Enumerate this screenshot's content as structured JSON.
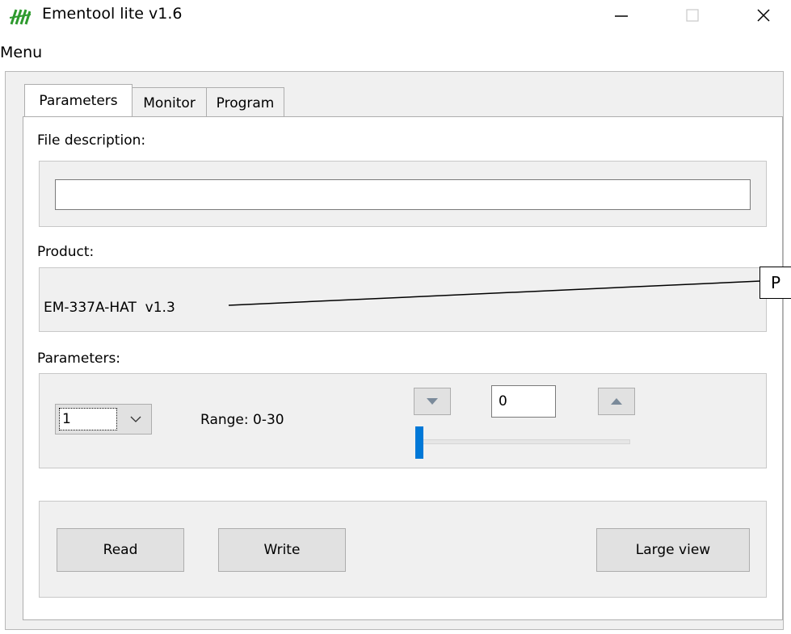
{
  "window": {
    "title": "Ementool lite v1.6",
    "menu": "Menu"
  },
  "tabs": [
    "Parameters",
    "Monitor",
    "Program"
  ],
  "file_description": {
    "label": "File description:",
    "value": ""
  },
  "product": {
    "label": "Product:",
    "value": "EM-337A-HAT  v1.3"
  },
  "parameters": {
    "label": "Parameters:",
    "selected": "1",
    "range_text": "Range: 0-30",
    "value": "0",
    "slider_value": 0
  },
  "buttons": {
    "read": "Read",
    "write": "Write",
    "large_view": "Large view"
  },
  "callout": {
    "text": "P"
  },
  "colors": {
    "accent": "#0078d7",
    "icon_green": "#2e9a2e"
  }
}
